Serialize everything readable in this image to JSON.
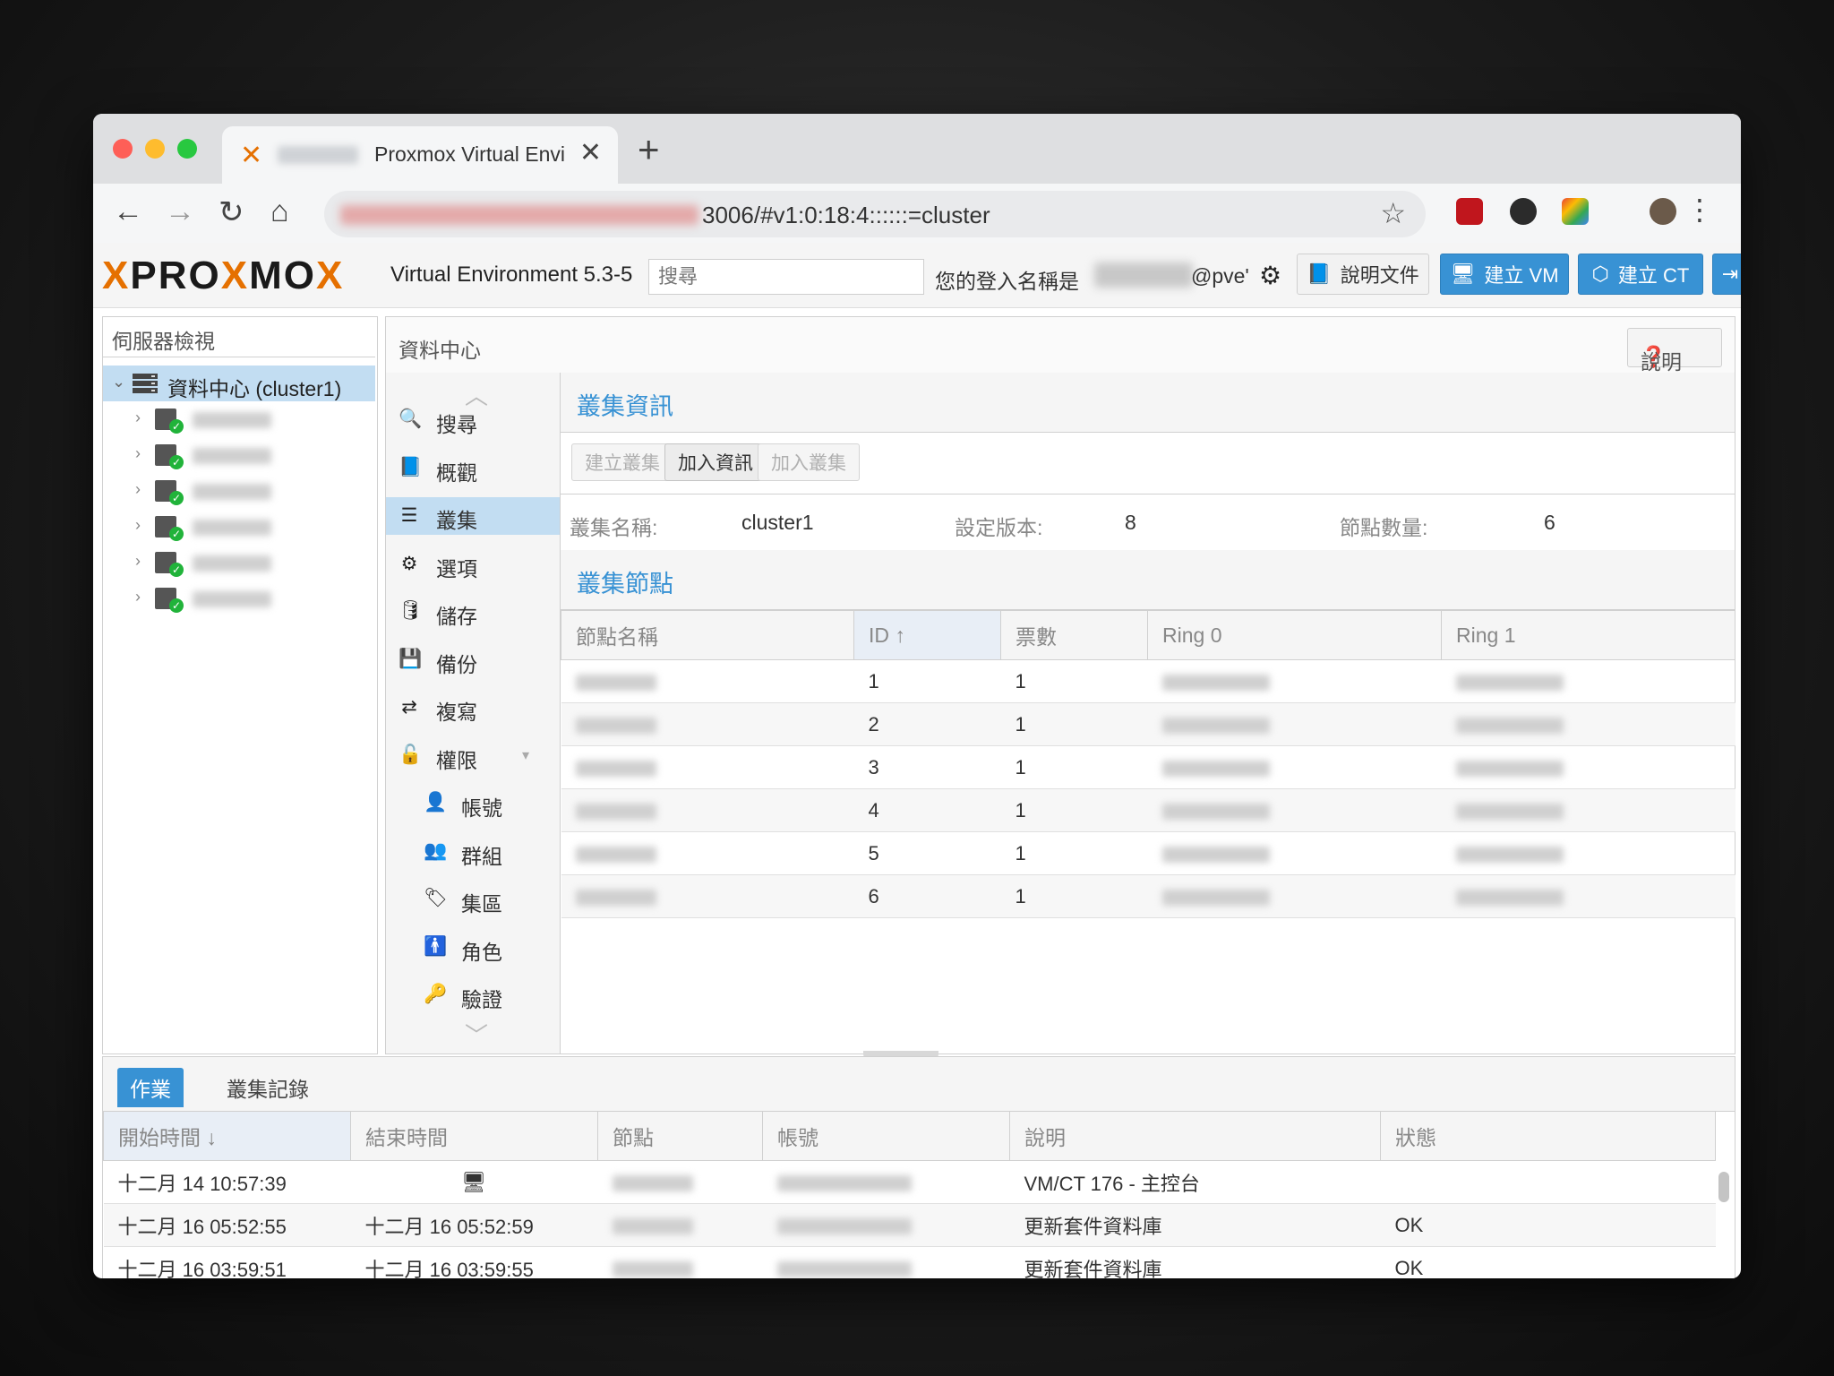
{
  "browser": {
    "tab_title": "Proxmox Virtual Envi",
    "close_glyph": "✕",
    "newtab_glyph": "+",
    "url": "3006/#v1:0:18:4::::::=cluster",
    "back_glyph": "←",
    "forward_glyph": "→",
    "reload_glyph": "↻",
    "home_glyph": "⌂",
    "star_glyph": "☆",
    "menu_glyph": "⋮"
  },
  "header": {
    "logo_x1": "X",
    "logo_pro": "PRO",
    "logo_x2": "X",
    "logo_mo": "MO",
    "logo_x3": "X",
    "version": "Virtual Environment 5.3-5",
    "search_placeholder": "搜尋",
    "login_label": "您的登入名稱是",
    "login_user": "@pve'",
    "docs_button": "說明文件",
    "create_vm_button": "建立 VM",
    "create_ct_button": "建立 CT"
  },
  "tree": {
    "view_select": "伺服器檢視",
    "root_label": "資料中心 (cluster1)",
    "node_count": 6
  },
  "content": {
    "title": "資料中心",
    "help_button": "說明",
    "menu": [
      {
        "icon": "search-icon",
        "glyph": "🔍",
        "label": "搜尋"
      },
      {
        "icon": "book-icon",
        "glyph": "📘",
        "label": "概觀"
      },
      {
        "icon": "server-icon",
        "glyph": "☰",
        "label": "叢集"
      },
      {
        "icon": "gear-icon",
        "glyph": "⚙",
        "label": "選項"
      },
      {
        "icon": "database-icon",
        "glyph": "🛢",
        "label": "儲存"
      },
      {
        "icon": "floppy-icon",
        "glyph": "💾",
        "label": "備份"
      },
      {
        "icon": "retweet-icon",
        "glyph": "⇄",
        "label": "複寫"
      },
      {
        "icon": "unlock-icon",
        "glyph": "🔓",
        "label": "權限"
      },
      {
        "icon": "user-icon",
        "glyph": "👤",
        "label": "帳號"
      },
      {
        "icon": "users-icon",
        "glyph": "👥",
        "label": "群組"
      },
      {
        "icon": "tags-icon",
        "glyph": "🏷",
        "label": "集區"
      },
      {
        "icon": "male-icon",
        "glyph": "🚹",
        "label": "角色"
      },
      {
        "icon": "key-icon",
        "glyph": "🔑",
        "label": "驗證"
      }
    ],
    "cluster_info": {
      "title": "叢集資訊",
      "buttons": {
        "create": "建立叢集",
        "join_info": "加入資訊",
        "join": "加入叢集"
      },
      "name_label": "叢集名稱:",
      "name_value": "cluster1",
      "version_label": "設定版本:",
      "version_value": "8",
      "nodes_label": "節點數量:",
      "nodes_value": "6"
    },
    "cluster_nodes": {
      "title": "叢集節點",
      "columns": [
        "節點名稱",
        "ID ↑",
        "票數",
        "Ring 0",
        "Ring 1"
      ],
      "rows": [
        {
          "id": "1",
          "votes": "1"
        },
        {
          "id": "2",
          "votes": "1"
        },
        {
          "id": "3",
          "votes": "1"
        },
        {
          "id": "4",
          "votes": "1"
        },
        {
          "id": "5",
          "votes": "1"
        },
        {
          "id": "6",
          "votes": "1"
        }
      ]
    }
  },
  "bottom": {
    "tabs": [
      "作業",
      "叢集記錄"
    ],
    "columns": [
      "開始時間 ↓",
      "結束時間",
      "節點",
      "帳號",
      "說明",
      "狀態"
    ],
    "rows": [
      {
        "start": "十二月 14 10:57:39",
        "end": "",
        "desc": "VM/CT 176 - 主控台",
        "status": ""
      },
      {
        "start": "十二月 16 05:52:55",
        "end": "十二月 16 05:52:59",
        "desc": "更新套件資料庫",
        "status": "OK"
      },
      {
        "start": "十二月 16 03:59:51",
        "end": "十二月 16 03:59:55",
        "desc": "更新套件資料庫",
        "status": "OK"
      }
    ]
  },
  "colors": {
    "accent": "#3892d4",
    "brand_orange": "#e57000",
    "selection": "#c2ddf2",
    "status_ok": "#21b33a"
  }
}
